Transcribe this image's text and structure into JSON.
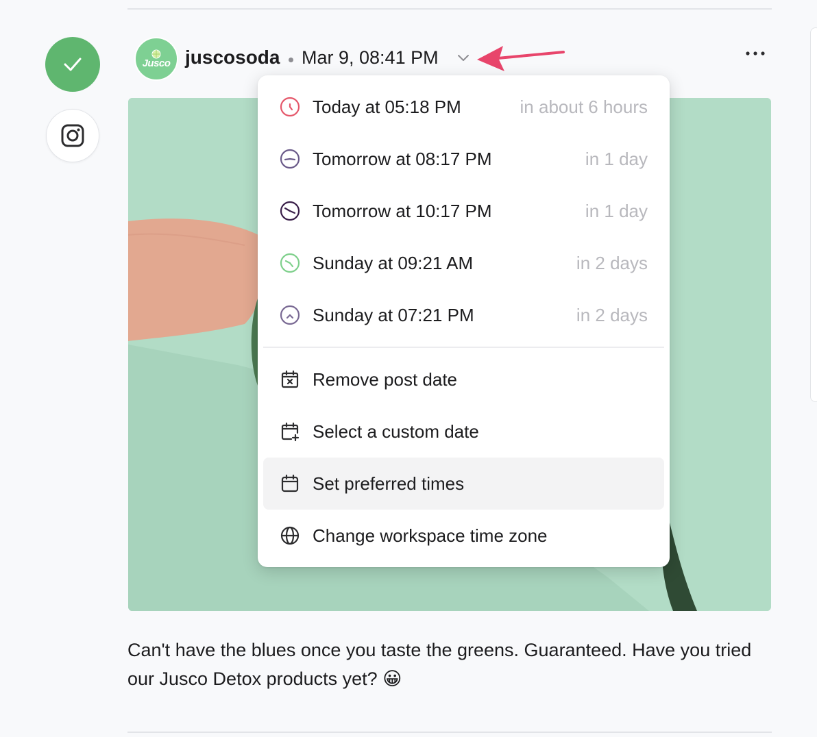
{
  "post": {
    "account_name": "juscosoda",
    "avatar_text": "Jusco",
    "date": "Mar 9, 08:41 PM",
    "caption": "Can't have the blues once you taste the greens. Guaranteed. Have you tried our Jusco Detox products yet?",
    "caption_emoji": "😀"
  },
  "schedule_menu": {
    "slots": [
      {
        "label": "Today at 05:18 PM",
        "relative": "in about 6 hours",
        "icon": "clock-icon",
        "color": "#e5586b"
      },
      {
        "label": "Tomorrow at 08:17 PM",
        "relative": "in 1 day",
        "icon": "clock-icon",
        "color": "#6b5b8a"
      },
      {
        "label": "Tomorrow at 10:17 PM",
        "relative": "in 1 day",
        "icon": "clock-icon",
        "color": "#3a1f4a"
      },
      {
        "label": "Sunday at 09:21 AM",
        "relative": "in 2 days",
        "icon": "clock-icon",
        "color": "#7fd08c"
      },
      {
        "label": "Sunday at 07:21 PM",
        "relative": "in 2 days",
        "icon": "clock-icon",
        "color": "#7a6a94"
      }
    ],
    "actions": [
      {
        "label": "Remove post date",
        "icon": "calendar-remove-icon"
      },
      {
        "label": "Select a custom date",
        "icon": "calendar-add-icon"
      },
      {
        "label": "Set preferred times",
        "icon": "calendar-icon"
      },
      {
        "label": "Change workspace time zone",
        "icon": "globe-icon"
      }
    ]
  },
  "colors": {
    "accent_green": "#5fb66f",
    "arrow_pink": "#e8456b",
    "image_bg": "#b2dcc6",
    "muted_text": "#b8b8bd"
  }
}
